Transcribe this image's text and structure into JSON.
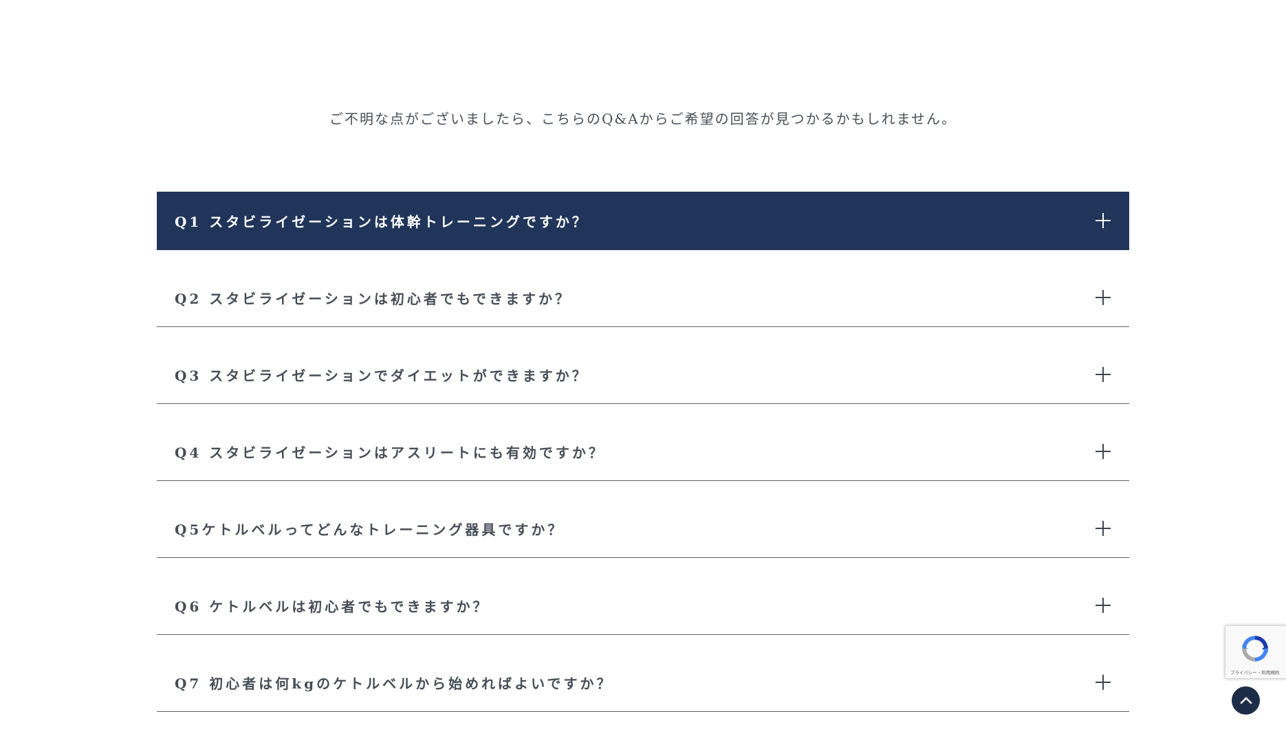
{
  "intro": {
    "text": "ご不明な点がございましたら、こちらのQ&Aからご希望の回答が見つかるかもしれません。"
  },
  "faq": {
    "items": [
      {
        "question": "Q1 スタビライゼーションは体幹トレーニングですか？",
        "expanded": false,
        "highlighted": true
      },
      {
        "question": "Q2 スタビライゼーションは初心者でもできますか？",
        "expanded": false,
        "highlighted": false
      },
      {
        "question": "Q3 スタビライゼーションでダイエットができますか？",
        "expanded": false,
        "highlighted": false
      },
      {
        "question": "Q4 スタビライゼーションはアスリートにも有効ですか？",
        "expanded": false,
        "highlighted": false
      },
      {
        "question": "Q5ケトルベルってどんなトレーニング器具ですか？",
        "expanded": false,
        "highlighted": false
      },
      {
        "question": "Q6 ケトルベルは初心者でもできますか？",
        "expanded": false,
        "highlighted": false
      },
      {
        "question": "Q7 初心者は何kgのケトルベルから始めればよいですか？",
        "expanded": false,
        "highlighted": false
      }
    ],
    "toggle_icon": "plus-icon"
  },
  "recaptcha": {
    "icon": "recaptcha-logo-icon",
    "footer_text": "プライバシー・利用規約"
  },
  "back_to_top": {
    "icon": "chevron-up-icon"
  },
  "colors": {
    "accent_navy": "#21355a",
    "text": "#474d56",
    "divider": "#5a5f66",
    "top_button": "#1e2d47"
  }
}
